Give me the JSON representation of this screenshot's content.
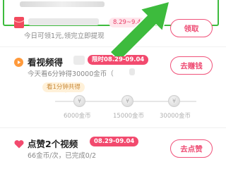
{
  "task1": {
    "date": "8.29~9.4",
    "subtitle": "今日可领1元,领完立即提现",
    "button": "领取"
  },
  "task2": {
    "title": "看视频得",
    "date": "限时08.29-09.04",
    "subtitle": "今天看6分钟得30000金币（",
    "button": "去赚钱",
    "tip": "看1分钟共得",
    "milestones": [
      {
        "label": "6000金币"
      },
      {
        "label": "15000金币"
      },
      {
        "label": "30000金币"
      }
    ]
  },
  "task3": {
    "title": "点赞2个视频",
    "date": "08.29-09.04",
    "subtitle": "66金币/次，已完成0/2",
    "button": "去点赞"
  },
  "colors": {
    "accent": "#f0527a",
    "arrow": "#3dbb3d"
  }
}
